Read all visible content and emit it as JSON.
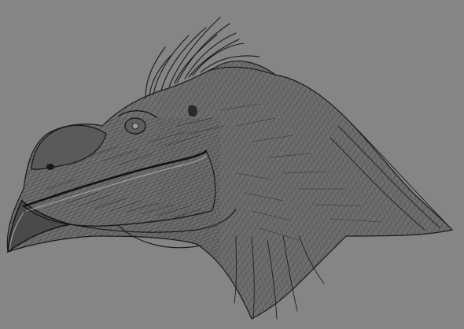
{
  "artwork": {
    "subject": "feathered-dinosaur-head-sketch",
    "style": "pen-hatching",
    "colors": {
      "background": "#858585",
      "ink_dark": "#1a1a1a",
      "ink_mid": "#2e2e2e",
      "highlight": "#a8a8a8"
    }
  }
}
